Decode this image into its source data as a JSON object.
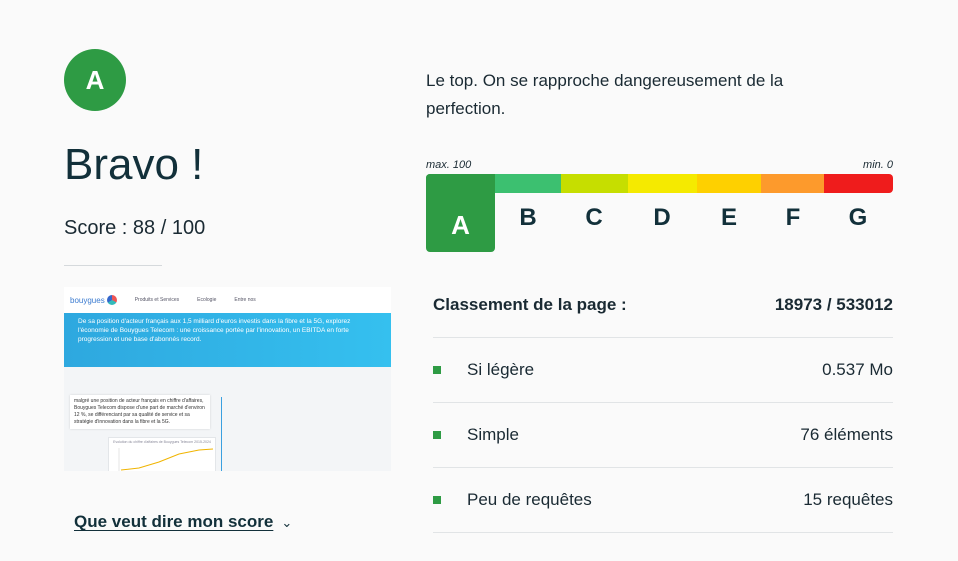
{
  "grade": {
    "letter": "A",
    "color": "#2e9b44"
  },
  "headline": "Bravo !",
  "score_text": "Score : 88 / 100",
  "description": "Le top. On se rapproche dangereusement de la perfection.",
  "scale": {
    "max_label": "max. 100",
    "min_label": "min. 0",
    "grades": [
      {
        "letter": "A",
        "color": "#2e9b44"
      },
      {
        "letter": "B",
        "color": "#3cc070"
      },
      {
        "letter": "C",
        "color": "#c6de00"
      },
      {
        "letter": "D",
        "color": "#f5ea00"
      },
      {
        "letter": "E",
        "color": "#fed000"
      },
      {
        "letter": "F",
        "color": "#fd9a2c"
      },
      {
        "letter": "G",
        "color": "#ef1c1c"
      }
    ],
    "active": "A"
  },
  "ranking": {
    "label": "Classement de la page :",
    "value": "18973 / 533012"
  },
  "stats": [
    {
      "label": "Si légère",
      "value": "0.537 Mo"
    },
    {
      "label": "Simple",
      "value": "76 éléments"
    },
    {
      "label": "Peu de requêtes",
      "value": "15 requêtes"
    }
  ],
  "score_link": "Que veut dire mon score",
  "thumbnail": {
    "logo": "bouygues",
    "nav": [
      "Produits et Services",
      "Ecologie",
      "Entre nos"
    ],
    "hero_text": "De sa position d'acteur français aux 1,5 milliard d'euros investis dans la fibre et la 5G, explorez l'économie de Bouygues Telecom : une croissance portée par l'innovation, un EBITDA en forte progression et une base d'abonnés record.",
    "card_text": "malgré une position de acteur français en chiffre d'affaires, Bouygues Telecom dispose d'une part de marché d'environ 12 %, se différenciant par sa qualité de service et sa stratégie d'innovation dans la fibre et la 5G.",
    "chart_title": "Evolution du chiffre d'affaires de Bouygues Telecom 2015-2024"
  }
}
